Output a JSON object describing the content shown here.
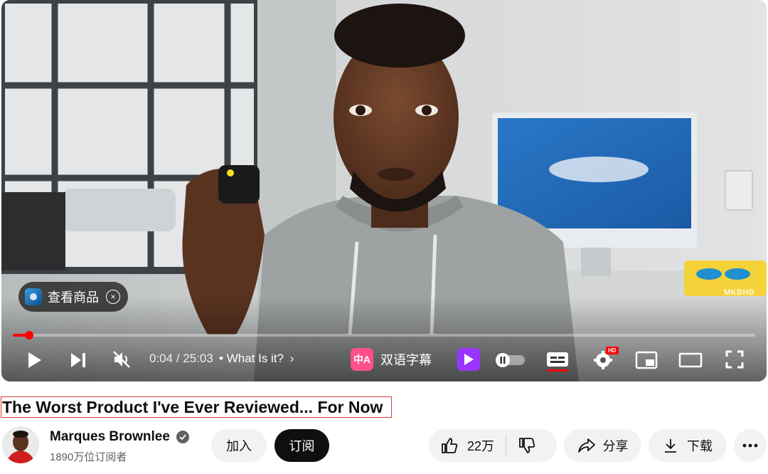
{
  "player": {
    "time_current": "0:04",
    "time_sep": " / ",
    "time_total": "25:03",
    "chapter_title": "What Is it?",
    "chapter_bullet": "•",
    "bilingual_badge": "中A",
    "bilingual_label": "双语字幕",
    "product_label": "查看商品",
    "watermark": "MKBHD",
    "quality_badge": "HD",
    "progress_fraction": 0.003
  },
  "video": {
    "title": "The Worst Product I've Ever Reviewed... For Now"
  },
  "channel": {
    "name": "Marques Brownlee",
    "subscribers": "1890万位订阅者"
  },
  "actions": {
    "join_label": "加入",
    "subscribe_label": "订阅",
    "like_count": "22万",
    "share_label": "分享",
    "download_label": "下载"
  },
  "colors": {
    "brand_red": "#ff0000",
    "bilingual_pink": "#ff4f8b",
    "autoplay_purple": "#9b34ff",
    "title_box_border": "#e03b3b"
  },
  "icons": [
    "play-icon",
    "next-icon",
    "mute-icon",
    "chevron-right-icon",
    "bilingual-subtitle-icon",
    "autoplay-toggle-icon",
    "pause-toggle-icon",
    "captions-icon",
    "settings-icon",
    "miniplayer-icon",
    "theater-mode-icon",
    "fullscreen-icon",
    "verified-icon",
    "like-icon",
    "dislike-icon",
    "share-icon",
    "download-icon",
    "more-icon",
    "close-icon"
  ]
}
